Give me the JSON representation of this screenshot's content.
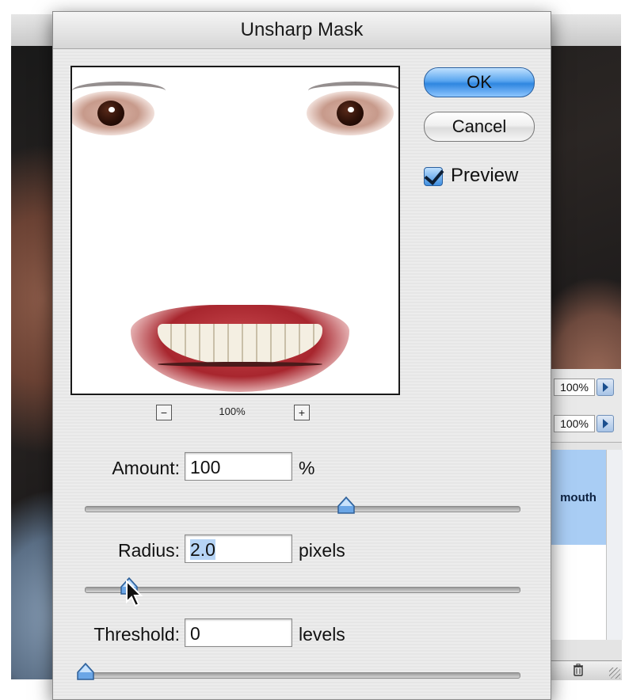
{
  "dialog": {
    "title": "Unsharp Mask",
    "zoom_label": "100%",
    "zoom_out_symbol": "−",
    "zoom_in_symbol": "+",
    "ok_label": "OK",
    "cancel_label": "Cancel",
    "preview_label": "Preview",
    "preview_checked": true,
    "amount": {
      "label": "Amount:",
      "value": "100",
      "unit": "%",
      "slider_fraction": 0.6
    },
    "radius": {
      "label": "Radius:",
      "value": "2.0",
      "unit": "pixels",
      "slider_fraction": 0.1
    },
    "threshold": {
      "label": "Threshold:",
      "value": "0",
      "unit": "levels",
      "slider_fraction": 0.0
    }
  },
  "side_panel": {
    "zoom_1": "100%",
    "zoom_2": "100%",
    "selected_layer": "mouth"
  },
  "colors": {
    "accent": "#3f8fe0",
    "selection": "#a9cdf4"
  }
}
